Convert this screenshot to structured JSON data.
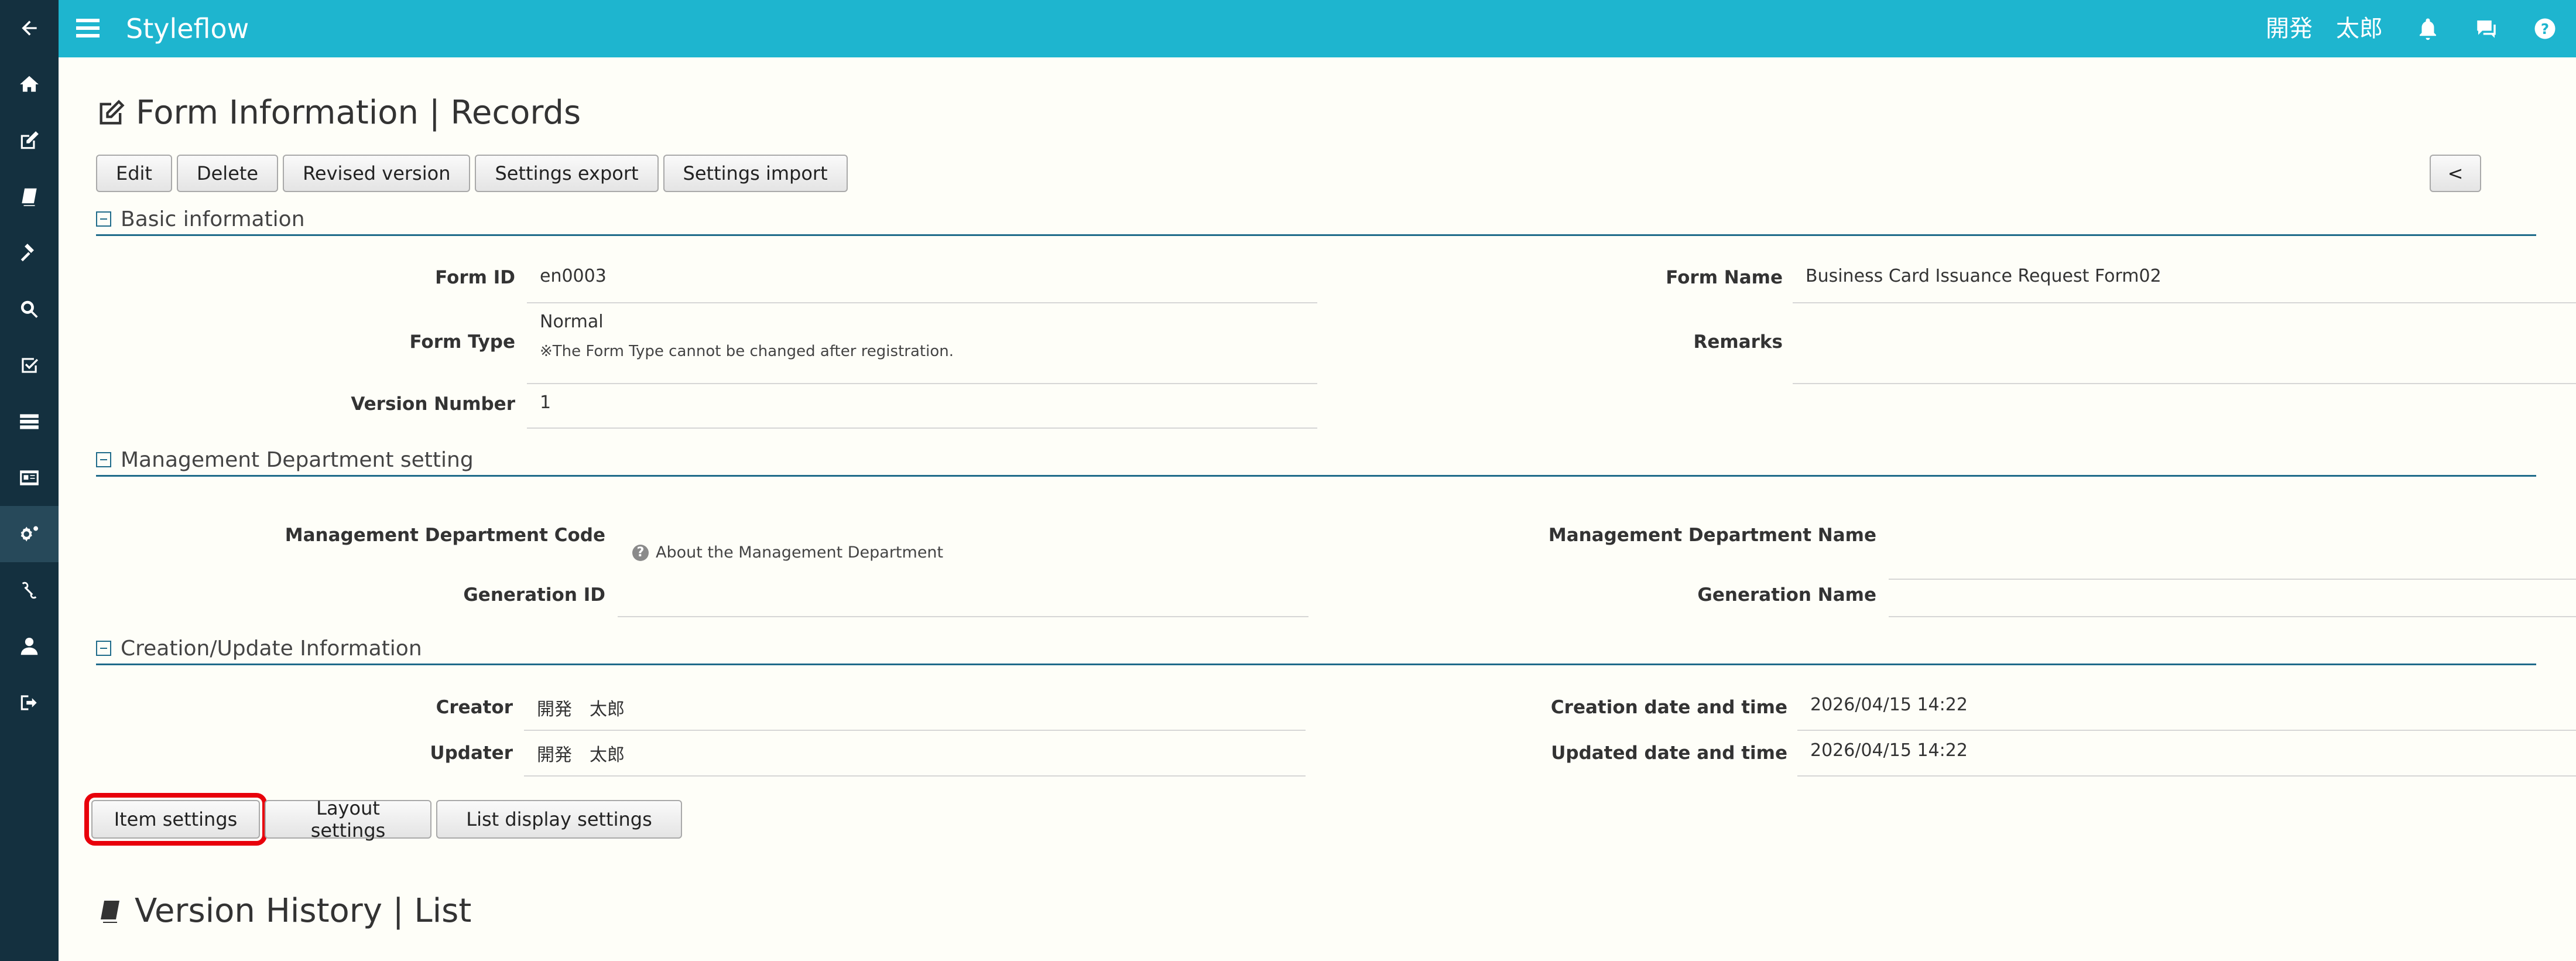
{
  "header": {
    "app_title": "Styleflow",
    "user_name": "開発　太郎",
    "icons": [
      "menu-icon",
      "bell-icon",
      "chat-icon",
      "help-icon"
    ]
  },
  "sidebar": {
    "items": [
      "back-arrow-icon",
      "home-icon",
      "edit-icon",
      "book-icon",
      "gavel-icon",
      "search-icon",
      "checkbox-icon",
      "server-icon",
      "id-card-icon",
      "gears-icon",
      "link-icon",
      "user-icon",
      "sign-out-icon"
    ],
    "active": "gears-icon"
  },
  "page": {
    "title": "Form Information | Records",
    "toolbar": {
      "edit": "Edit",
      "delete": "Delete",
      "revised_version": "Revised version",
      "settings_export": "Settings export",
      "settings_import": "Settings import",
      "back": "<"
    }
  },
  "basic": {
    "header": "Basic information",
    "form_id_label": "Form ID",
    "form_id": "en0003",
    "form_name_label": "Form Name",
    "form_name": "Business Card Issuance Request Form02",
    "form_type_label": "Form Type",
    "form_type": "Normal",
    "form_type_note": "※The Form Type cannot be changed after registration.",
    "remarks_label": "Remarks",
    "remarks": "",
    "version_label": "Version Number",
    "version": "1"
  },
  "management": {
    "header": "Management Department setting",
    "code_label": "Management Department Code",
    "code": "",
    "help_text": "About the Management Department",
    "name_label": "Management Department Name",
    "name": "",
    "generation_id_label": "Generation ID",
    "generation_id": "",
    "generation_name_label": "Generation Name",
    "generation_name": ""
  },
  "creation": {
    "header": "Creation/Update Information",
    "creator_label": "Creator",
    "creator": "開発　太郎",
    "creation_dt_label": "Creation date and time",
    "creation_dt": "2026/04/15 14:22",
    "updater_label": "Updater",
    "updater": "開発　太郎",
    "updated_dt_label": "Updated date and time",
    "updated_dt": "2026/04/15 14:22"
  },
  "bottom": {
    "item_settings": "Item settings",
    "layout_settings": "Layout settings",
    "list_display_settings": "List display settings"
  },
  "history": {
    "title": "Version History | List"
  },
  "colors": {
    "header_bg": "#1eb5cf",
    "sidebar_bg": "#14303f",
    "highlight": "#e8000b"
  }
}
